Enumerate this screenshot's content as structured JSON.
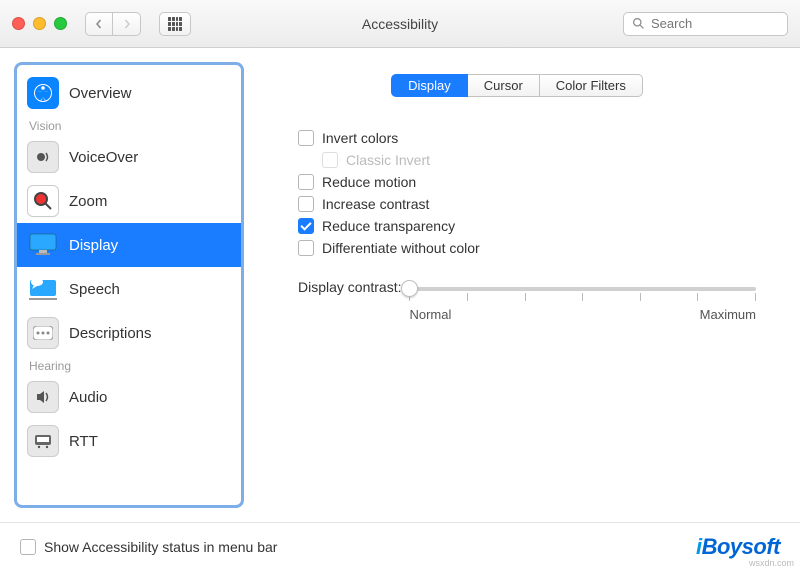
{
  "window": {
    "title": "Accessibility"
  },
  "search": {
    "placeholder": "Search"
  },
  "sidebar": {
    "items": [
      {
        "label": "Overview"
      },
      {
        "section": "Vision"
      },
      {
        "label": "VoiceOver"
      },
      {
        "label": "Zoom"
      },
      {
        "label": "Display",
        "selected": true
      },
      {
        "label": "Speech"
      },
      {
        "label": "Descriptions"
      },
      {
        "section": "Hearing"
      },
      {
        "label": "Audio"
      },
      {
        "label": "RTT"
      }
    ]
  },
  "tabs": [
    {
      "label": "Display",
      "active": true
    },
    {
      "label": "Cursor"
    },
    {
      "label": "Color Filters"
    }
  ],
  "options": {
    "invert_colors": "Invert colors",
    "classic_invert": "Classic Invert",
    "reduce_motion": "Reduce motion",
    "increase_contrast": "Increase contrast",
    "reduce_transparency": "Reduce transparency",
    "differentiate": "Differentiate without color"
  },
  "checked": {
    "reduce_transparency": true
  },
  "slider": {
    "label": "Display contrast:",
    "min_label": "Normal",
    "max_label": "Maximum",
    "value_pct": 0
  },
  "footer": {
    "status_label": "Show Accessibility status in menu bar"
  },
  "brand": "iBoysoft",
  "watermark": "wsxdn.com"
}
